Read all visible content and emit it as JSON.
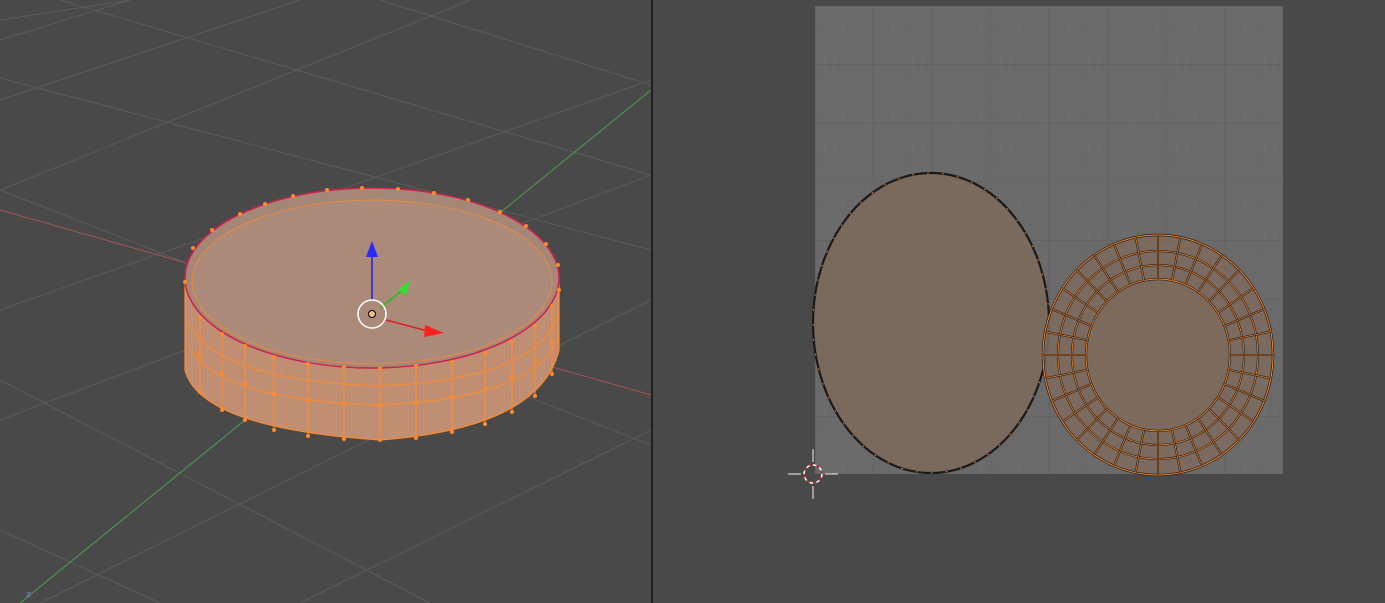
{
  "viewport_3d": {
    "object": "cylinder-mesh",
    "mode": "edit",
    "axis_corner_label": "z",
    "colors": {
      "background": "#494949",
      "grid_line": "#5b5b5b",
      "x_axis": "#a25454",
      "y_axis": "#4d9d4d",
      "mesh_fill": "#c08f73",
      "selected_edge": "#ff8a2a",
      "vertex": "#ff8a2a",
      "seam": "#d02050",
      "manipulator_x": "#e02020",
      "manipulator_y": "#20c020",
      "manipulator_z": "#2020e0"
    }
  },
  "uv_editor": {
    "islands": [
      "uv-top-face-island",
      "uv-side-ring-island"
    ],
    "colors": {
      "background": "#494949",
      "image_fill": "#6a6a6a",
      "grid_fine": "#727272",
      "grid_major": "#5e5e5e",
      "face_fill": "#7c6a5d",
      "edge": "#ff8a2a",
      "outline": "#1a1a1a"
    }
  }
}
